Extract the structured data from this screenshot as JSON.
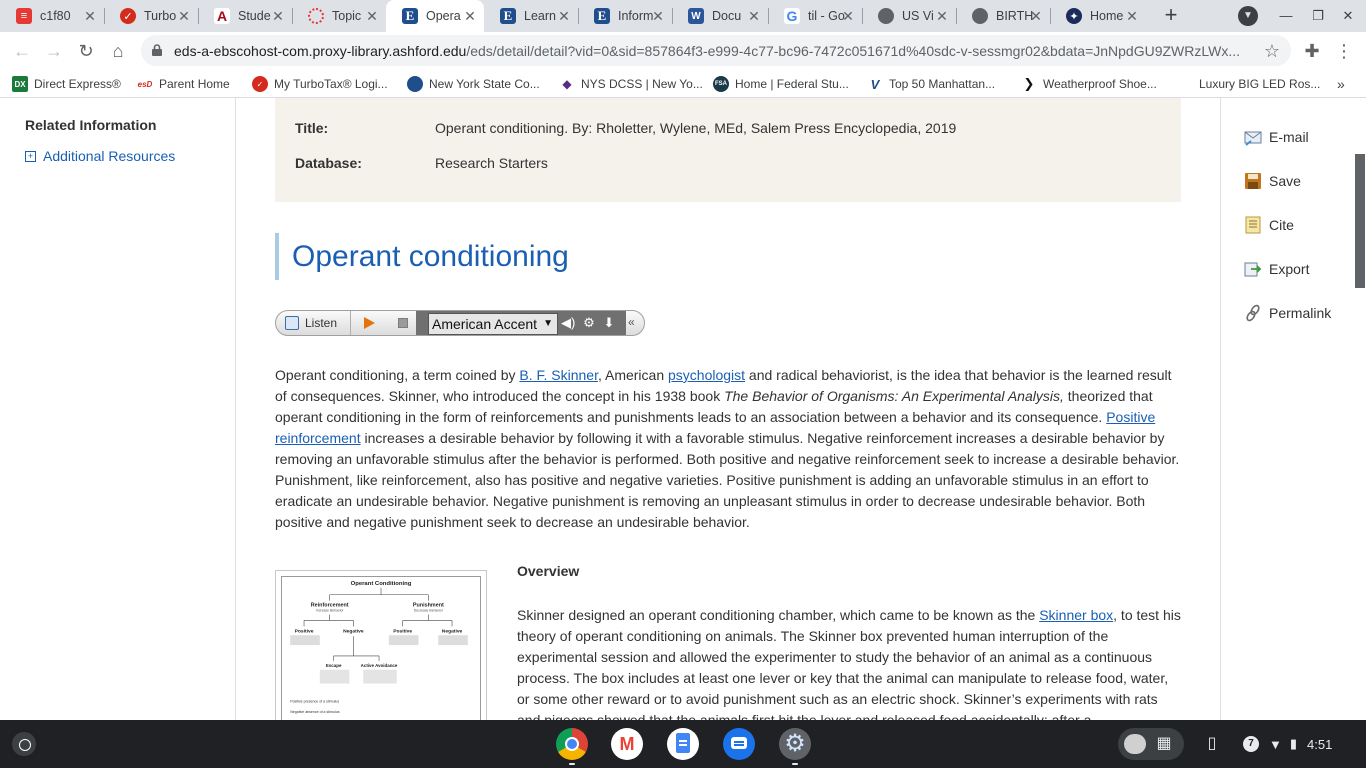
{
  "browser": {
    "tabs": [
      {
        "title": "c1f80",
        "icon": "pdf-icon",
        "color": "#e53935"
      },
      {
        "title": "Turbo",
        "icon": "turbotax-icon",
        "color": "#d52b1e"
      },
      {
        "title": "Stude",
        "icon": "arizona-icon",
        "color": "#ab0520"
      },
      {
        "title": "Topic",
        "icon": "loading-icon",
        "color": "#e53935"
      },
      {
        "title": "Opera",
        "icon": "ebsco-icon",
        "color": "#1f4e8c"
      },
      {
        "title": "Learn",
        "icon": "ebsco-icon",
        "color": "#1f4e8c"
      },
      {
        "title": "Inform",
        "icon": "ebsco-icon",
        "color": "#1f4e8c"
      },
      {
        "title": "Docu",
        "icon": "word-icon",
        "color": "#2b579a"
      },
      {
        "title": "til - Go",
        "icon": "google-icon",
        "color": "#4285f4"
      },
      {
        "title": "US Vi",
        "icon": "globe-icon",
        "color": "#5f6368"
      },
      {
        "title": "BIRTH",
        "icon": "globe-icon",
        "color": "#5f6368"
      },
      {
        "title": "Home",
        "icon": "home-icon",
        "color": "#1c2b5a"
      }
    ],
    "url_domain": "eds-a-ebscohost-com.proxy-library.ashford.edu",
    "url_path": "/eds/detail/detail?vid=0&sid=857864f3-e999-4c77-bc96-7472c051671d%40sdc-v-sessmgr02&bdata=JnNpdGU9ZWRzLWx...",
    "bookmarks": [
      {
        "label": "Direct Express®",
        "icon": "dx-icon",
        "color": "#1b7a3a"
      },
      {
        "label": "Parent Home",
        "icon": "esd-icon",
        "color": "#d52b1e"
      },
      {
        "label": "My TurboTax® Logi...",
        "icon": "turbotax-icon",
        "color": "#d52b1e"
      },
      {
        "label": "New York State Co...",
        "icon": "seal-icon",
        "color": "#1f4e8c"
      },
      {
        "label": "NYS DCSS | New Yo...",
        "icon": "nys-icon",
        "color": "#5b2c83"
      },
      {
        "label": "Home | Federal Stu...",
        "icon": "fsa-icon",
        "color": "#1a3a4a"
      },
      {
        "label": "Top 50 Manhattan...",
        "icon": "v-icon",
        "color": "#1f4e8c"
      },
      {
        "label": "Weatherproof Shoe...",
        "icon": "chevron-icon",
        "color": "#111111"
      },
      {
        "label": "Luxury BIG LED Ros...",
        "icon": "none",
        "color": "#ffffff"
      }
    ]
  },
  "sidebar": {
    "heading": "Related Information",
    "link": "Additional Resources"
  },
  "meta": {
    "title_label": "Title:",
    "title_value": "Operant conditioning. By: Rholetter, Wylene, MEd, Salem Press Encyclopedia, 2019",
    "database_label": "Database:",
    "database_value": "Research Starters"
  },
  "article": {
    "heading": "Operant conditioning",
    "listen_label": "Listen",
    "accent": "American Accent",
    "p1": {
      "a": "Operant conditioning, a term coined by ",
      "link1": "B. F. Skinner",
      "b": ", American ",
      "link2": "psychologist",
      "c": " and radical behaviorist, is the idea that behavior is the learned result of consequences. Skinner, who introduced the concept in his 1938 book ",
      "book": "The Behavior of Organisms: An Experimental Analysis,",
      "d": " theorized that operant conditioning in the form of reinforcements and punishments leads to an association between a behavior and its consequence. ",
      "link3": "Positive reinforcement",
      "e": " increases a desirable behavior by following it with a favorable stimulus. Negative reinforcement increases a desirable behavior by removing an unfavorable stimulus after the behavior is performed. Both positive and negative reinforcement seek to increase a desirable behavior. Punishment, like reinforcement, also has positive and negative varieties. Positive punishment is adding an unfavorable stimulus in an effort to eradicate an undesirable behavior. Negative punishment is removing an unpleasant stimulus in order to decrease undesirable behavior. Both positive and negative punishment seek to decrease an undesirable behavior."
    },
    "overview_heading": "Overview",
    "p2": {
      "a": "Skinner designed an operant conditioning chamber, which came to be known as the ",
      "link": "Skinner box",
      "b": ", to test his theory of operant conditioning on animals. The Skinner box prevented human interruption of the experimental session and allowed the experimenter to study the behavior of an animal as a continuous process. The box includes at least one lever or key that the animal can manipulate to release food, water, or some other reward or to avoid punishment such as an electric shock. Skinner’s experiments with rats and pigeons showed that the animals first hit the lever and released food accidentally; after a"
    },
    "figure": {
      "title": "Operant Conditioning",
      "reinforcement": "Reinforcement",
      "reinforcement_sub": "Increase Behavior",
      "punishment": "Punishment",
      "punishment_sub": "Decrease Behavior",
      "positive": "Positive",
      "negative": "Negative",
      "escape": "Escape",
      "active_avoidance": "Active Avoidance",
      "positive_note": "Positive presence of a stimulus",
      "negative_note": "Negative absence of a stimulus"
    }
  },
  "tools": [
    {
      "label": "E-mail",
      "icon": "email-icon"
    },
    {
      "label": "Save",
      "icon": "save-icon"
    },
    {
      "label": "Cite",
      "icon": "cite-icon"
    },
    {
      "label": "Export",
      "icon": "export-icon"
    },
    {
      "label": "Permalink",
      "icon": "link-icon"
    }
  ],
  "shelf": {
    "apps": [
      "chrome-icon",
      "gmail-icon",
      "docs-icon",
      "messages-icon",
      "settings-icon"
    ],
    "notification_count": "7",
    "time": "4:51"
  }
}
